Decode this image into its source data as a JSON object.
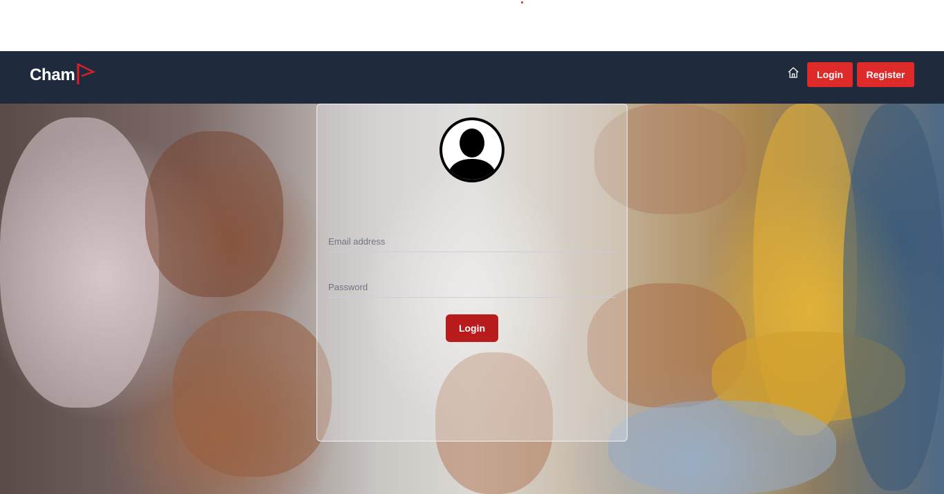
{
  "brand": {
    "name": "Cham"
  },
  "nav": {
    "login_label": "Login",
    "register_label": "Register"
  },
  "form": {
    "email_placeholder": "Email address",
    "password_placeholder": "Password",
    "submit_label": "Login"
  },
  "icons": {
    "home": "home-icon",
    "avatar": "user-avatar-icon",
    "brand_flag": "flag-icon"
  },
  "colors": {
    "navbar": "#1f2a3c",
    "accent_red": "#df2a2a",
    "submit_red": "#b91c1c",
    "text_white": "#ffffff"
  }
}
